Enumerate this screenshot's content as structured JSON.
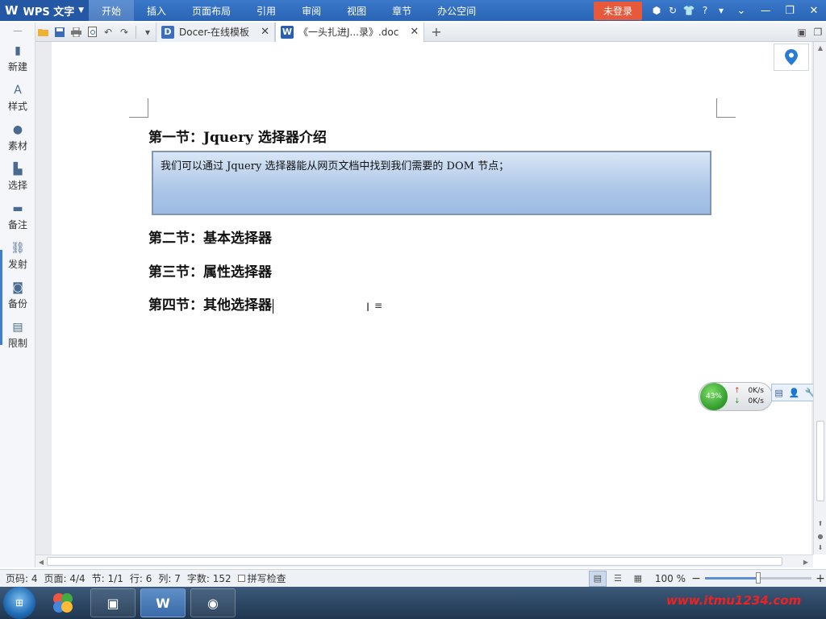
{
  "app": {
    "name": "WPS 文字",
    "colors": {
      "titlebar": "#2a64b5",
      "login": "#e8583a",
      "shape_fill": "#a9c4e6",
      "accent": "#3f7fd0"
    }
  },
  "menu": {
    "items": [
      {
        "label": "开始",
        "active": true
      },
      {
        "label": "插入"
      },
      {
        "label": "页面布局"
      },
      {
        "label": "引用"
      },
      {
        "label": "审阅"
      },
      {
        "label": "视图"
      },
      {
        "label": "章节"
      },
      {
        "label": "办公空间"
      }
    ],
    "login_label": "未登录"
  },
  "tabs": [
    {
      "label": "Docer-在线模板",
      "icon": "docer-icon",
      "active": false
    },
    {
      "label": "《一头扎进J...录》.doc",
      "icon": "word-doc-icon",
      "active": true
    }
  ],
  "sidebar": {
    "items": [
      {
        "label": "新建",
        "icon": "new-doc-icon"
      },
      {
        "label": "样式",
        "icon": "style-icon"
      },
      {
        "label": "素材",
        "icon": "material-icon"
      },
      {
        "label": "选择",
        "icon": "select-icon"
      },
      {
        "label": "备注",
        "icon": "comment-icon"
      },
      {
        "label": "发射",
        "icon": "link-icon"
      },
      {
        "label": "备份",
        "icon": "backup-icon"
      },
      {
        "label": "限制",
        "icon": "restrict-icon"
      }
    ]
  },
  "document": {
    "heading1": "第一节：Jquery 选择器介绍",
    "shape_text": "我们可以通过 Jquery 选择器能从网页文档中找到我们需要的 DOM 节点；",
    "heading2": "第二节：基本选择器",
    "heading3": "第三节：属性选择器",
    "heading4": "第四节：其他选择器"
  },
  "netmon": {
    "percent": "43%",
    "up_rate": "0K/s",
    "down_rate": "0K/s"
  },
  "status": {
    "page_num": "页码: 4",
    "pages": "页面: 4/4",
    "section": "节: 1/1",
    "row": "行: 6",
    "col": "列: 7",
    "word_count": "字数: 152",
    "spell_check": "拼写检查",
    "zoom": "100 %",
    "zoom_level": 0.5
  },
  "watermark": "www.itmu1234.com"
}
